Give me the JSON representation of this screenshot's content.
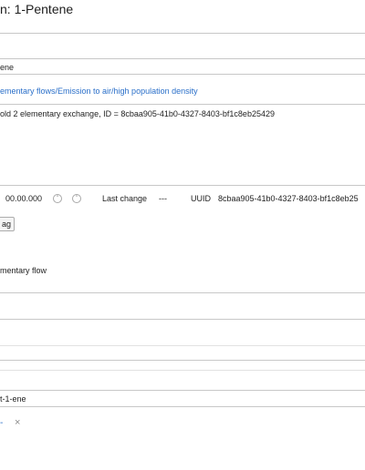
{
  "editor": {
    "title": "n: 1-Pentene"
  },
  "fields": {
    "name_value": "ene",
    "category_link": "ementary flows/Emission to air/high population density",
    "description": "old 2 elementary exchange, ID = 8cbaa905-41b0-4327-8403-bf1c8eb25429",
    "version": "00.00.000",
    "last_change_label": "Last change",
    "last_change_value": "---",
    "uuid_label": "UUID",
    "uuid_value": "8cbaa905-41b0-4327-8403-bf1c8eb25",
    "tag_button": "ag",
    "flow_type": "mentary flow",
    "synonym_value": "t-1-ene",
    "add_symbol": "-",
    "remove_symbol": "×"
  },
  "colors": {
    "link": "#2a6fc9",
    "border": "#c8c8c8"
  }
}
